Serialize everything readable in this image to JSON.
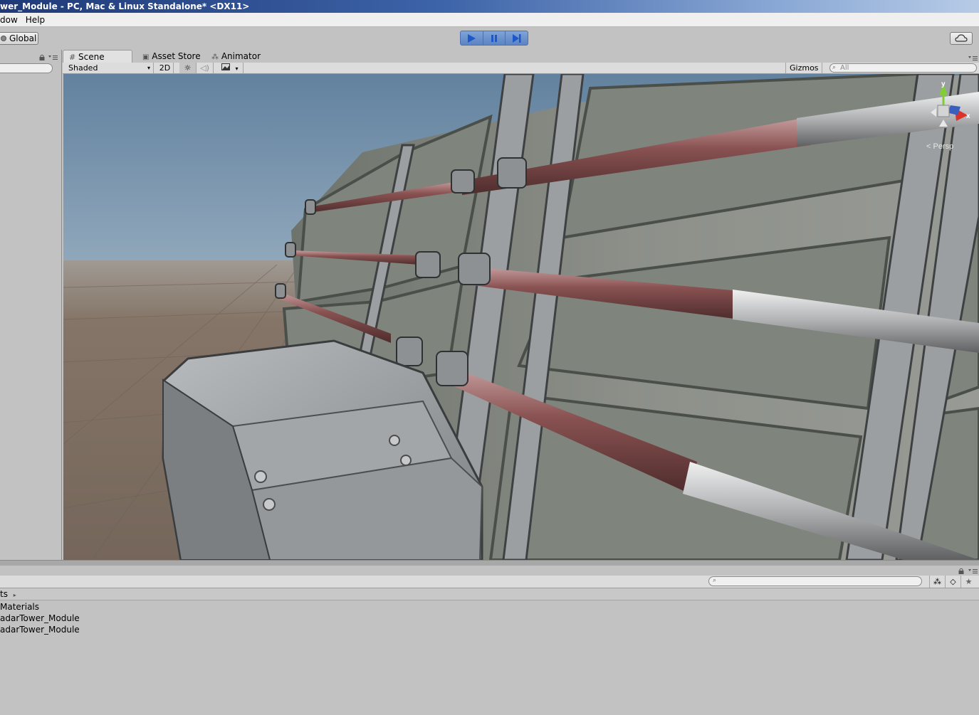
{
  "window": {
    "title": "wer_Module - PC, Mac & Linux Standalone* <DX11>"
  },
  "menu": {
    "items": [
      "dow",
      "Help"
    ]
  },
  "toolbar": {
    "global_label": "Global"
  },
  "scene": {
    "tabs": [
      {
        "label": "Scene"
      },
      {
        "label": "Asset Store"
      },
      {
        "label": "Animator"
      }
    ],
    "shading_mode": "Shaded",
    "toggle_2d": "2D",
    "gizmos_label": "Gizmos",
    "search_placeholder": "All",
    "persp_label": "Persp",
    "axis_y": "y",
    "axis_x": "x"
  },
  "project": {
    "breadcrumb": "ts",
    "items": [
      "Materials",
      "adarTower_Module",
      "adarTower_Module"
    ]
  },
  "colors": {
    "play_accent": "#5c83c3",
    "sky_top": "#6d8fb8",
    "ground": "#857568"
  }
}
